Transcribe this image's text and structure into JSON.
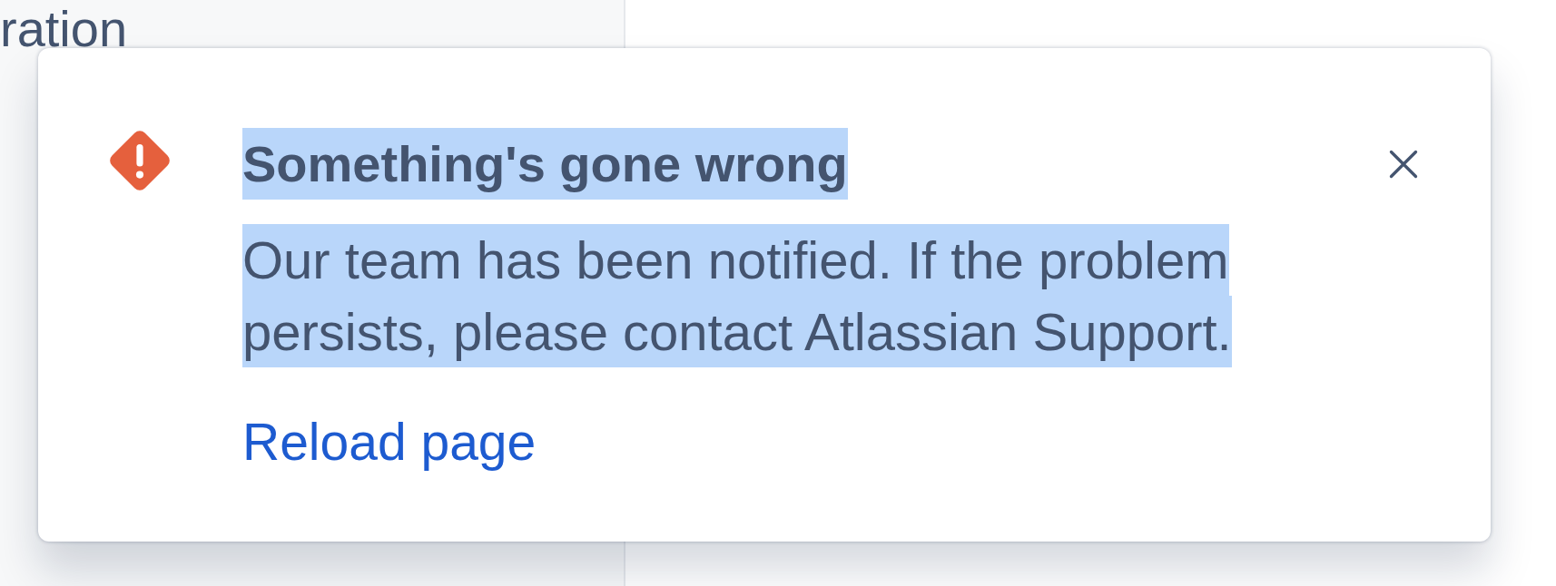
{
  "sidebar": {
    "text": "ration"
  },
  "flag": {
    "title": "Something's gone wrong",
    "description": "Our team has been notified. If the problem persists, please contact Atlassian Support.",
    "text_selected": true,
    "actions": [
      {
        "label": "Reload page"
      }
    ]
  }
}
